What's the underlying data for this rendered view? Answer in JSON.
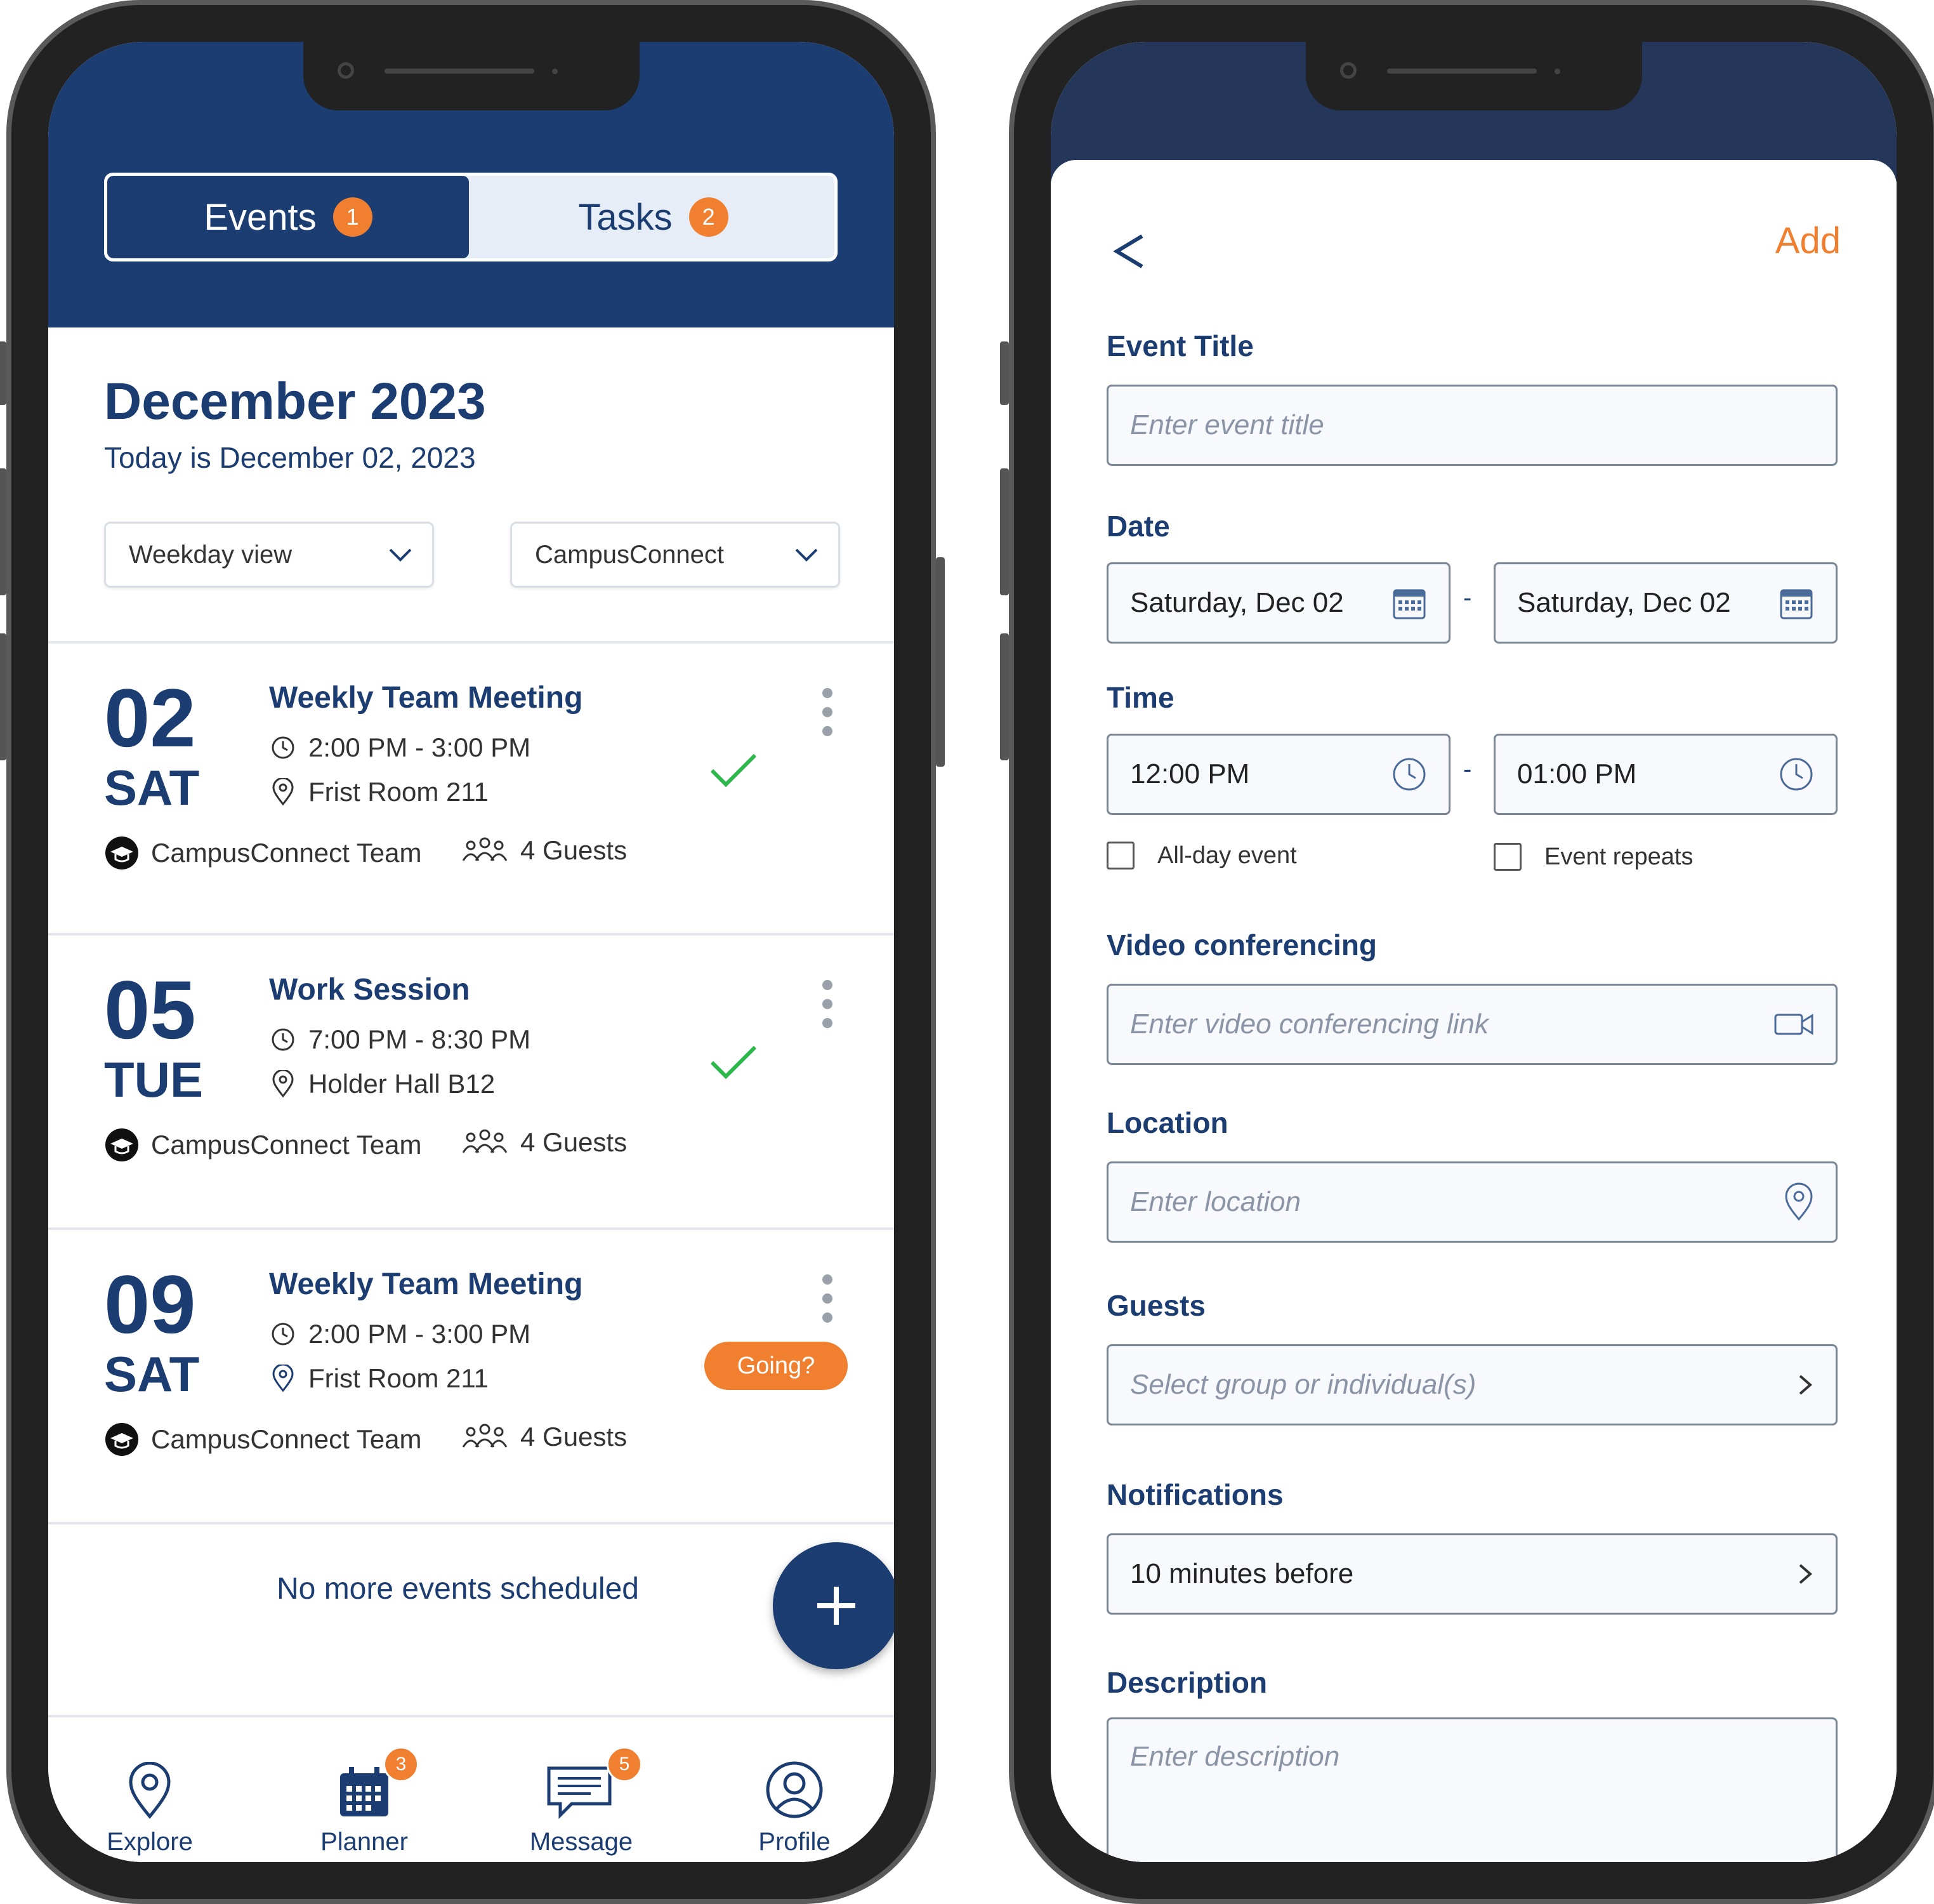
{
  "left": {
    "tabs": {
      "events_label": "Events",
      "events_badge": "1",
      "tasks_label": "Tasks",
      "tasks_badge": "2"
    },
    "month_title": "December 2023",
    "today_text": "Today is December 02, 2023",
    "view_dropdown": "Weekday view",
    "calendar_dropdown": "CampusConnect",
    "events": [
      {
        "day": "02",
        "dow": "SAT",
        "title": "Weekly Team Meeting",
        "time": "2:00 PM - 3:00 PM",
        "location": "Frist Room 211",
        "organizer": "CampusConnect Team",
        "guests": "4 Guests",
        "status": "confirmed"
      },
      {
        "day": "05",
        "dow": "TUE",
        "title": "Work Session",
        "time": "7:00 PM - 8:30 PM",
        "location": "Holder Hall B12",
        "organizer": "CampusConnect Team",
        "guests": "4 Guests",
        "status": "confirmed"
      },
      {
        "day": "09",
        "dow": "SAT",
        "title": "Weekly Team Meeting",
        "time": "2:00 PM - 3:00 PM",
        "location": "Frist Room 211",
        "organizer": "CampusConnect Team",
        "guests": "4 Guests",
        "status": "Going?"
      }
    ],
    "no_more_text": "No more events scheduled",
    "nav": {
      "explore": "Explore",
      "planner": "Planner",
      "planner_badge": "3",
      "message": "Message",
      "message_badge": "5",
      "profile": "Profile"
    }
  },
  "right": {
    "add_label": "Add",
    "event_title_label": "Event Title",
    "event_title_placeholder": "Enter event title",
    "date_label": "Date",
    "date_start": "Saturday, Dec 02",
    "date_end": "Saturday, Dec 02",
    "time_label": "Time",
    "time_start": "12:00 PM",
    "time_end": "01:00 PM",
    "all_day_label": "All-day event",
    "repeats_label": "Event repeats",
    "video_label": "Video conferencing",
    "video_placeholder": "Enter video conferencing link",
    "location_label": "Location",
    "location_placeholder": "Enter location",
    "guests_label": "Guests",
    "guests_placeholder": "Select group or individual(s)",
    "notifications_label": "Notifications",
    "notifications_value": "10 minutes before",
    "description_label": "Description",
    "description_placeholder": "Enter description",
    "separator": "-"
  },
  "colors": {
    "brand_navy": "#1c3d72",
    "accent_orange": "#f08030",
    "check_green": "#2db84c"
  }
}
